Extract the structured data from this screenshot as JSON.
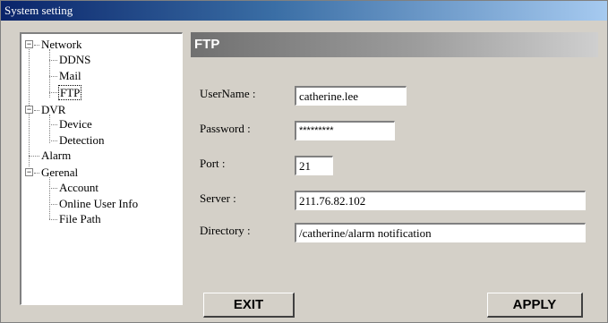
{
  "window": {
    "title": "System setting"
  },
  "tree": {
    "network": {
      "label": "Network",
      "expander": "−",
      "children": [
        "DDNS",
        "Mail",
        "FTP"
      ]
    },
    "dvr": {
      "label": "DVR",
      "expander": "−",
      "children": [
        "Device",
        "Detection"
      ]
    },
    "alarm": {
      "label": "Alarm"
    },
    "general": {
      "label": "Gerenal",
      "expander": "−",
      "children": [
        "Account",
        "Online User Info",
        "File Path"
      ]
    },
    "selected": "FTP"
  },
  "ftp": {
    "header": "FTP",
    "username": {
      "label": "UserName :",
      "value": "catherine.lee"
    },
    "password": {
      "label": "Password :",
      "value": "*********"
    },
    "port": {
      "label": "Port :",
      "value": "21"
    },
    "server": {
      "label": "Server  :",
      "value": "211.76.82.102"
    },
    "directory": {
      "label": "Directory :",
      "value": "/catherine/alarm notification"
    }
  },
  "buttons": {
    "exit": "EXIT",
    "apply": "APPLY"
  }
}
